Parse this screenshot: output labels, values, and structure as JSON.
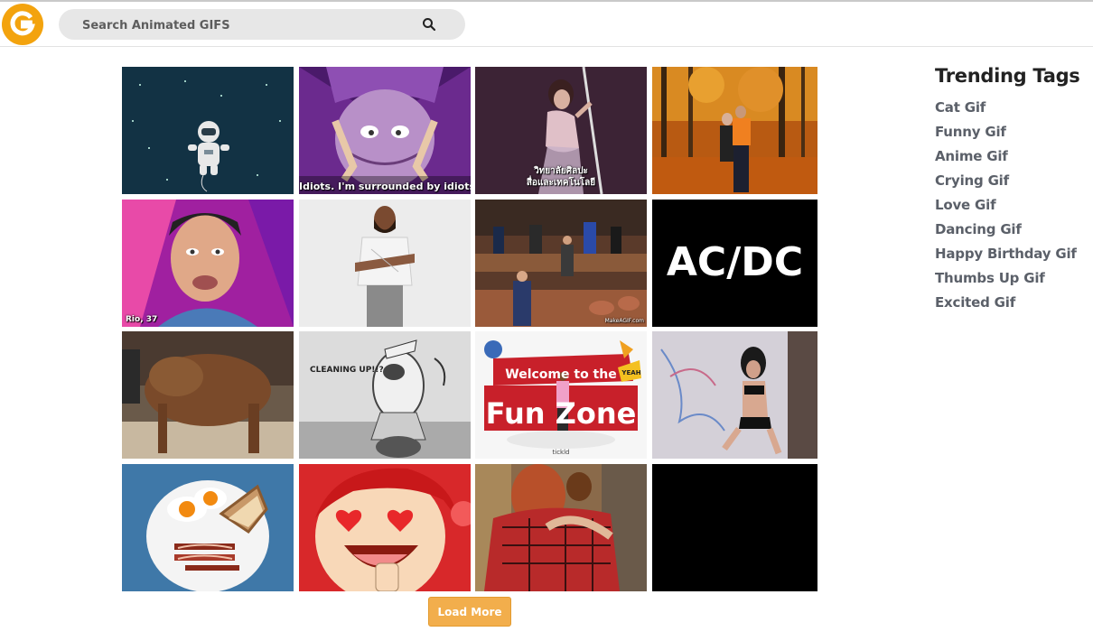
{
  "header": {
    "logo_letter": "G",
    "search_placeholder": "Search Animated GIFS"
  },
  "grid": {
    "tiles": [
      {
        "name": "astronaut-gif",
        "caption": ""
      },
      {
        "name": "yzma-gif",
        "caption": "Idiots. I'm surrounded by idiots"
      },
      {
        "name": "pole-dancer-gif",
        "caption_line1": "วิทยาลัยศิลปะ",
        "caption_line2": "สื่อและเทคโนโลยี"
      },
      {
        "name": "autumn-couple-gif",
        "caption": ""
      },
      {
        "name": "drag-queen-gif",
        "caption": "Rio, 37"
      },
      {
        "name": "man-white-shirt-gif",
        "caption": ""
      },
      {
        "name": "parliament-dance-gif",
        "caption": "MakeAGIF.com"
      },
      {
        "name": "acdc-logo-gif",
        "caption": "AC/DC"
      },
      {
        "name": "furry-creature-gif",
        "caption": ""
      },
      {
        "name": "cleaning-up-sketch-gif",
        "caption": "CLEANING UP!!?"
      },
      {
        "name": "fun-zone-gif",
        "caption_line1": "Welcome to the",
        "caption_line2": "Fun Zone",
        "caption_badge": "YEAH",
        "caption_small": "tickld"
      },
      {
        "name": "graffiti-pose-gif",
        "caption": ""
      },
      {
        "name": "breakfast-gif",
        "caption": ""
      },
      {
        "name": "heart-eyes-cartoon-gif",
        "caption": ""
      },
      {
        "name": "hugging-couple-gif",
        "caption": ""
      },
      {
        "name": "black-loading-gif",
        "caption": ""
      }
    ]
  },
  "load_more_label": "Load More",
  "trending": {
    "title": "Trending Tags",
    "tags": [
      "Cat Gif",
      "Funny Gif",
      "Anime Gif",
      "Crying Gif",
      "Love Gif",
      "Dancing Gif",
      "Happy Birthday Gif",
      "Thumbs Up Gif",
      "Excited Gif"
    ]
  },
  "colors": {
    "brand_orange": "#f3a30e",
    "button_orange": "#f2ae4c",
    "tag_text": "#5b6069",
    "search_bg": "#e7e7e7"
  },
  "icons": {
    "search": "magnifier-icon",
    "logo": "giphy-style-g-logo-icon"
  }
}
